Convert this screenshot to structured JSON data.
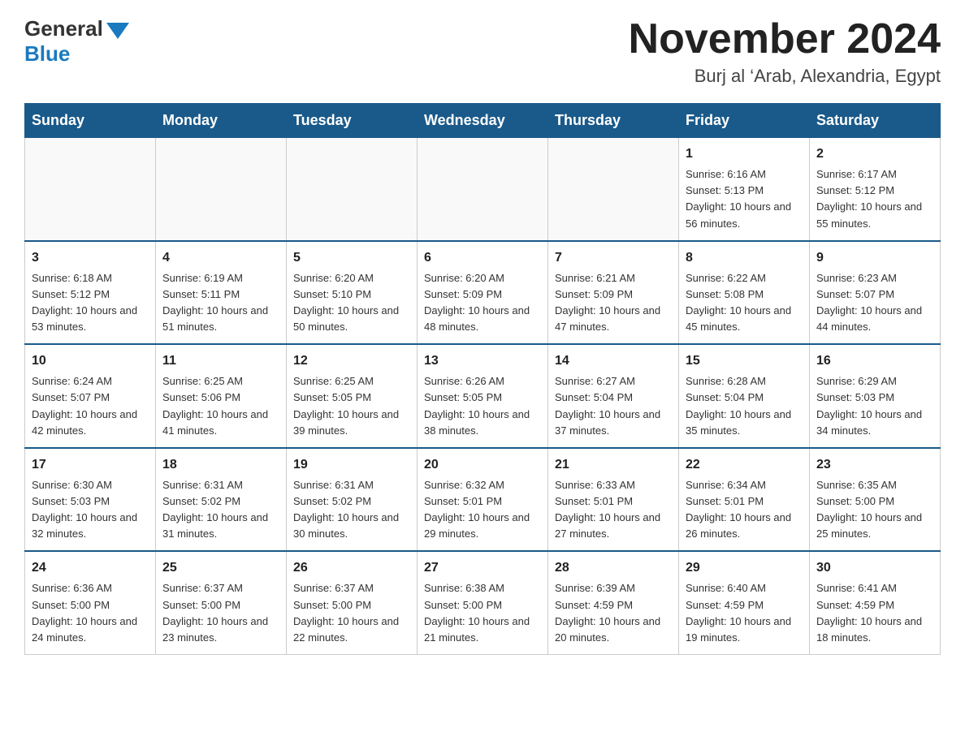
{
  "header": {
    "logo_general": "General",
    "logo_blue": "Blue",
    "month_title": "November 2024",
    "subtitle": "Burj al ‘Arab, Alexandria, Egypt"
  },
  "days_of_week": [
    "Sunday",
    "Monday",
    "Tuesday",
    "Wednesday",
    "Thursday",
    "Friday",
    "Saturday"
  ],
  "weeks": [
    [
      {
        "day": "",
        "sunrise": "",
        "sunset": "",
        "daylight": ""
      },
      {
        "day": "",
        "sunrise": "",
        "sunset": "",
        "daylight": ""
      },
      {
        "day": "",
        "sunrise": "",
        "sunset": "",
        "daylight": ""
      },
      {
        "day": "",
        "sunrise": "",
        "sunset": "",
        "daylight": ""
      },
      {
        "day": "",
        "sunrise": "",
        "sunset": "",
        "daylight": ""
      },
      {
        "day": "1",
        "sunrise": "Sunrise: 6:16 AM",
        "sunset": "Sunset: 5:13 PM",
        "daylight": "Daylight: 10 hours and 56 minutes."
      },
      {
        "day": "2",
        "sunrise": "Sunrise: 6:17 AM",
        "sunset": "Sunset: 5:12 PM",
        "daylight": "Daylight: 10 hours and 55 minutes."
      }
    ],
    [
      {
        "day": "3",
        "sunrise": "Sunrise: 6:18 AM",
        "sunset": "Sunset: 5:12 PM",
        "daylight": "Daylight: 10 hours and 53 minutes."
      },
      {
        "day": "4",
        "sunrise": "Sunrise: 6:19 AM",
        "sunset": "Sunset: 5:11 PM",
        "daylight": "Daylight: 10 hours and 51 minutes."
      },
      {
        "day": "5",
        "sunrise": "Sunrise: 6:20 AM",
        "sunset": "Sunset: 5:10 PM",
        "daylight": "Daylight: 10 hours and 50 minutes."
      },
      {
        "day": "6",
        "sunrise": "Sunrise: 6:20 AM",
        "sunset": "Sunset: 5:09 PM",
        "daylight": "Daylight: 10 hours and 48 minutes."
      },
      {
        "day": "7",
        "sunrise": "Sunrise: 6:21 AM",
        "sunset": "Sunset: 5:09 PM",
        "daylight": "Daylight: 10 hours and 47 minutes."
      },
      {
        "day": "8",
        "sunrise": "Sunrise: 6:22 AM",
        "sunset": "Sunset: 5:08 PM",
        "daylight": "Daylight: 10 hours and 45 minutes."
      },
      {
        "day": "9",
        "sunrise": "Sunrise: 6:23 AM",
        "sunset": "Sunset: 5:07 PM",
        "daylight": "Daylight: 10 hours and 44 minutes."
      }
    ],
    [
      {
        "day": "10",
        "sunrise": "Sunrise: 6:24 AM",
        "sunset": "Sunset: 5:07 PM",
        "daylight": "Daylight: 10 hours and 42 minutes."
      },
      {
        "day": "11",
        "sunrise": "Sunrise: 6:25 AM",
        "sunset": "Sunset: 5:06 PM",
        "daylight": "Daylight: 10 hours and 41 minutes."
      },
      {
        "day": "12",
        "sunrise": "Sunrise: 6:25 AM",
        "sunset": "Sunset: 5:05 PM",
        "daylight": "Daylight: 10 hours and 39 minutes."
      },
      {
        "day": "13",
        "sunrise": "Sunrise: 6:26 AM",
        "sunset": "Sunset: 5:05 PM",
        "daylight": "Daylight: 10 hours and 38 minutes."
      },
      {
        "day": "14",
        "sunrise": "Sunrise: 6:27 AM",
        "sunset": "Sunset: 5:04 PM",
        "daylight": "Daylight: 10 hours and 37 minutes."
      },
      {
        "day": "15",
        "sunrise": "Sunrise: 6:28 AM",
        "sunset": "Sunset: 5:04 PM",
        "daylight": "Daylight: 10 hours and 35 minutes."
      },
      {
        "day": "16",
        "sunrise": "Sunrise: 6:29 AM",
        "sunset": "Sunset: 5:03 PM",
        "daylight": "Daylight: 10 hours and 34 minutes."
      }
    ],
    [
      {
        "day": "17",
        "sunrise": "Sunrise: 6:30 AM",
        "sunset": "Sunset: 5:03 PM",
        "daylight": "Daylight: 10 hours and 32 minutes."
      },
      {
        "day": "18",
        "sunrise": "Sunrise: 6:31 AM",
        "sunset": "Sunset: 5:02 PM",
        "daylight": "Daylight: 10 hours and 31 minutes."
      },
      {
        "day": "19",
        "sunrise": "Sunrise: 6:31 AM",
        "sunset": "Sunset: 5:02 PM",
        "daylight": "Daylight: 10 hours and 30 minutes."
      },
      {
        "day": "20",
        "sunrise": "Sunrise: 6:32 AM",
        "sunset": "Sunset: 5:01 PM",
        "daylight": "Daylight: 10 hours and 29 minutes."
      },
      {
        "day": "21",
        "sunrise": "Sunrise: 6:33 AM",
        "sunset": "Sunset: 5:01 PM",
        "daylight": "Daylight: 10 hours and 27 minutes."
      },
      {
        "day": "22",
        "sunrise": "Sunrise: 6:34 AM",
        "sunset": "Sunset: 5:01 PM",
        "daylight": "Daylight: 10 hours and 26 minutes."
      },
      {
        "day": "23",
        "sunrise": "Sunrise: 6:35 AM",
        "sunset": "Sunset: 5:00 PM",
        "daylight": "Daylight: 10 hours and 25 minutes."
      }
    ],
    [
      {
        "day": "24",
        "sunrise": "Sunrise: 6:36 AM",
        "sunset": "Sunset: 5:00 PM",
        "daylight": "Daylight: 10 hours and 24 minutes."
      },
      {
        "day": "25",
        "sunrise": "Sunrise: 6:37 AM",
        "sunset": "Sunset: 5:00 PM",
        "daylight": "Daylight: 10 hours and 23 minutes."
      },
      {
        "day": "26",
        "sunrise": "Sunrise: 6:37 AM",
        "sunset": "Sunset: 5:00 PM",
        "daylight": "Daylight: 10 hours and 22 minutes."
      },
      {
        "day": "27",
        "sunrise": "Sunrise: 6:38 AM",
        "sunset": "Sunset: 5:00 PM",
        "daylight": "Daylight: 10 hours and 21 minutes."
      },
      {
        "day": "28",
        "sunrise": "Sunrise: 6:39 AM",
        "sunset": "Sunset: 4:59 PM",
        "daylight": "Daylight: 10 hours and 20 minutes."
      },
      {
        "day": "29",
        "sunrise": "Sunrise: 6:40 AM",
        "sunset": "Sunset: 4:59 PM",
        "daylight": "Daylight: 10 hours and 19 minutes."
      },
      {
        "day": "30",
        "sunrise": "Sunrise: 6:41 AM",
        "sunset": "Sunset: 4:59 PM",
        "daylight": "Daylight: 10 hours and 18 minutes."
      }
    ]
  ]
}
